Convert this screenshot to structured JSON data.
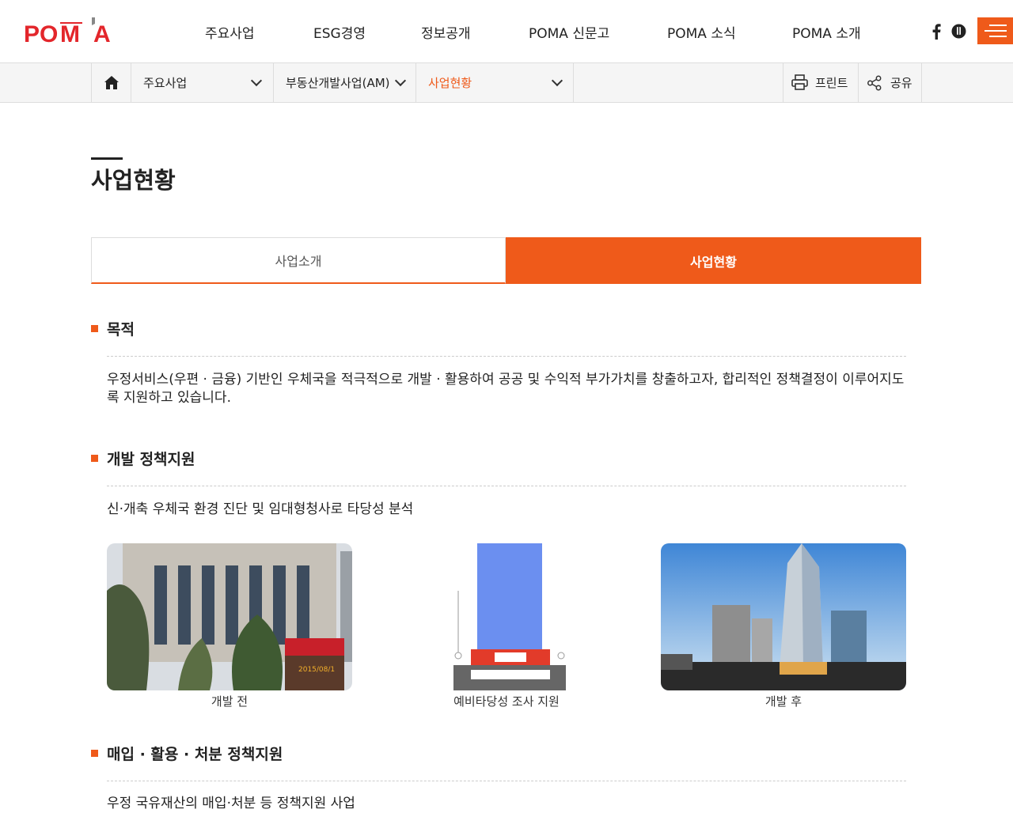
{
  "brand": {
    "logo": "POMA",
    "accent": "#ef5a1a"
  },
  "header": {
    "menu": [
      "주요사업",
      "ESG경영",
      "정보공개",
      "POMA 신문고",
      "POMA 소식",
      "POMA 소개"
    ],
    "icons": [
      "facebook-icon",
      "blog-icon",
      "hamburger-menu-icon"
    ]
  },
  "subnav": {
    "home": "home-icon",
    "level1": "주요사업",
    "level2": "부동산개발사업(AM)",
    "level3": "사업현황",
    "print": "프린트",
    "share": "공유"
  },
  "page": {
    "title": "사업현황"
  },
  "tabs": [
    {
      "label": "사업소개",
      "active": false
    },
    {
      "label": "사업현황",
      "active": true
    }
  ],
  "sections": [
    {
      "heading": "목적",
      "body": "우정서비스(우편 · 금융) 기반인 우체국을 적극적으로 개발 · 활용하여 공공 및 수익적 부가가치를 창출하고자, 합리적인 정책결정이 이루어지도록 지원하고 있습니다."
    },
    {
      "heading": "개발 정책지원",
      "body": "신·개축 우체국 환경 진단 및 임대형청사로 타당성 분석",
      "figures": [
        {
          "caption": "개발 전",
          "stamp": "2015/08/1"
        },
        {
          "caption": "예비타당성 조사 지원"
        },
        {
          "caption": "개발 후"
        }
      ]
    },
    {
      "heading": "매입 · 활용 · 처분 정책지원",
      "body": "우정 국유재산의 매입·처분 등 정책지원 사업"
    }
  ]
}
